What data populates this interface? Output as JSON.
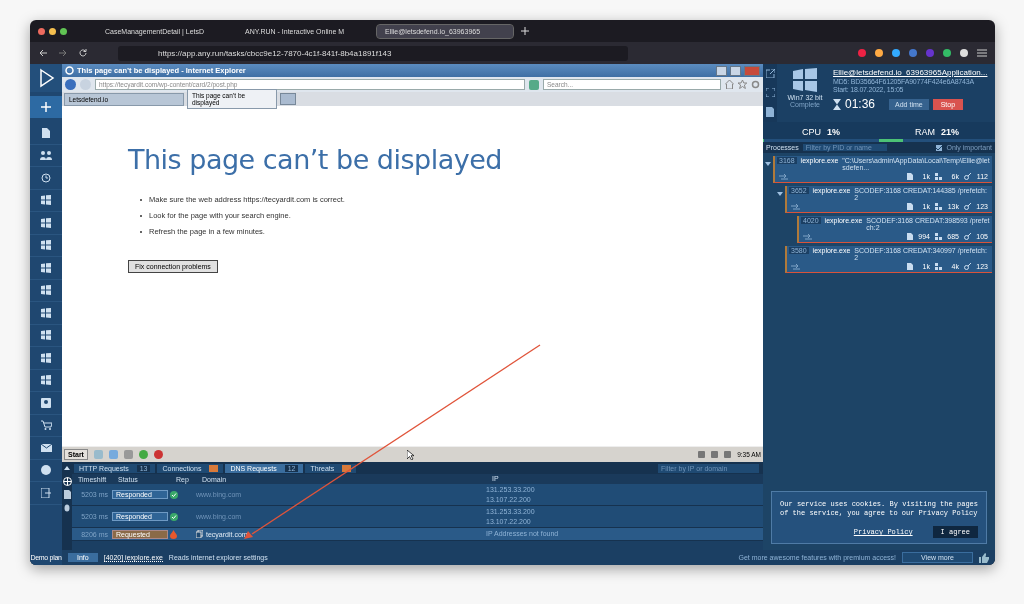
{
  "browser": {
    "tabs": [
      {
        "label": "CaseManagementDetail | LetsD",
        "selected": false
      },
      {
        "label": "ANY.RUN - Interactive Online M",
        "selected": false
      },
      {
        "label": "Ellie@letsdefend.io_63963965",
        "selected": true
      }
    ],
    "url": "https://app.any.run/tasks/cbcc9e12-7870-4c1f-841f-8b4a1891f143"
  },
  "ie": {
    "title": "This page can’t be displayed - Internet Explorer",
    "address": "https://tecyardit.com/wp-content/card/2/post.php",
    "search_placeholder": "Search...",
    "tabs": [
      {
        "label": "Letsdefend.io",
        "selected": false
      },
      {
        "label": "This page can’t be displayed",
        "selected": true
      }
    ],
    "heading": "This page can’t be displayed",
    "bullets": [
      "Make sure the web address https://tecyardit.com is correct.",
      "Look for the page with your search engine.",
      "Refresh the page in a few minutes."
    ],
    "button": "Fix connection problems"
  },
  "taskbar": {
    "start": "Start",
    "clock": "9:35 AM"
  },
  "task": {
    "name": "Ellie@letsdefend.io_63963965Application...",
    "md5": "MD5: BD35664F61205FA90774F424e6A8743A",
    "start": "Start: 18.07.2022, 15:05",
    "os": "Win7 32 bit",
    "status": "Complete",
    "timer": "01:36",
    "add_time": "Add time",
    "stop": "Stop",
    "cpu": {
      "label": "CPU",
      "reading": "1%",
      "level": 0.01
    },
    "ram": {
      "label": "RAM",
      "reading": "21%",
      "level": 0.21
    }
  },
  "processes": {
    "title": "Processes",
    "filter_placeholder": "Filter by PID or name",
    "only_important": {
      "label": "Only important",
      "checked": true
    },
    "tree": [
      {
        "pid": "3168",
        "name": "iexplore.exe",
        "command": "\"C:\\Users\\admin\\AppData\\Local\\Temp\\Ellie@letsdefen...",
        "files": "1k",
        "registry": "6k",
        "modules": "112",
        "expanded": true,
        "children": [
          {
            "pid": "3652",
            "name": "iexplore.exe",
            "command": "SCODEF:3168 CREDAT:144385 /prefetch:2",
            "files": "1k",
            "registry": "13k",
            "modules": "123",
            "expanded": true,
            "children": [
              {
                "pid": "4020",
                "name": "iexplore.exe",
                "command": "SCODEF:3168 CREDAT:398593 /prefetch:2",
                "files": "994",
                "registry": "685",
                "modules": "105",
                "expanded": false
              }
            ]
          },
          {
            "pid": "3580",
            "name": "iexplore.exe",
            "command": "SCODEF:3168 CREDAT:340997 /prefetch:2",
            "files": "1k",
            "registry": "4k",
            "modules": "123",
            "expanded": false
          }
        ]
      }
    ]
  },
  "network": {
    "tabs": [
      {
        "label": "HTTP Requests",
        "count": "13",
        "warning": false,
        "selected": false
      },
      {
        "label": "Connections",
        "warning": true,
        "selected": false
      },
      {
        "label": "DNS Requests",
        "count": "12",
        "warning": false,
        "selected": true
      },
      {
        "label": "Threats",
        "warning": true,
        "selected": false
      }
    ],
    "filter_placeholder": "Filter by IP or domain",
    "columns": [
      "Timeshift",
      "Status",
      "Rep",
      "Domain",
      "IP"
    ],
    "rows": [
      {
        "timeshift": "5203 ms",
        "status": "Responded",
        "kind": "safe",
        "domain": "www.bing.com",
        "ips": [
          "131.253.33.200",
          "13.107.22.200"
        ]
      },
      {
        "timeshift": "5203 ms",
        "status": "Responded",
        "kind": "safe",
        "domain": "www.bing.com",
        "ips": [
          "131.253.33.200",
          "13.107.22.200"
        ]
      },
      {
        "timeshift": "8206 ms",
        "status": "Requested",
        "kind": "malicious",
        "domain": "tecyardit.com",
        "ips": [
          "IP Addresses not found"
        ]
      }
    ]
  },
  "cookie": {
    "text": "Our service uses cookies. By visiting the pages of the service, you agree to our Privacy Policy",
    "link": "Privacy Policy",
    "agree": "I agree"
  },
  "status_bar": {
    "plan": "Demo plan",
    "info": "Info",
    "process": "[4020] iexplore.exe",
    "event": "Reads internet explorer settings",
    "promo": "Get more awesome features with premium access!",
    "view_more": "View more"
  }
}
